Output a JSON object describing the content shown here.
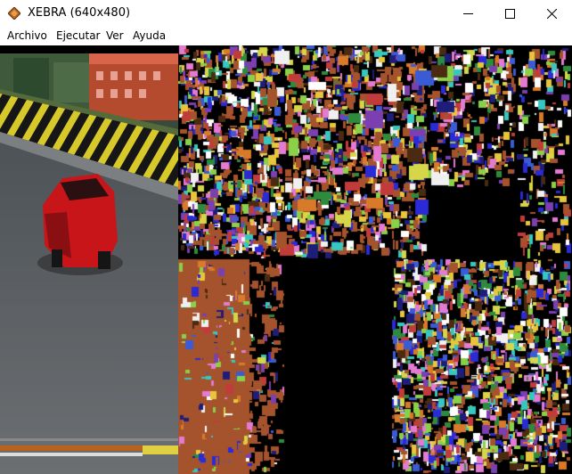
{
  "window": {
    "title": "XEBRA (640x480)",
    "icon": "xebra-diamond-icon"
  },
  "controls": {
    "minimize": "minimize-icon",
    "maximize": "maximize-icon",
    "close": "close-icon"
  },
  "menu": {
    "items": [
      {
        "label": "Archivo"
      },
      {
        "label": "Ejecutar"
      },
      {
        "label": "Ver"
      },
      {
        "label": "Ayuda"
      }
    ]
  },
  "viewport": {
    "content": "emulator-display",
    "colors": {
      "sky": "#6b7a63",
      "road": "#5e6166",
      "car": "#c8151a",
      "texture_bg": "#000000"
    }
  }
}
